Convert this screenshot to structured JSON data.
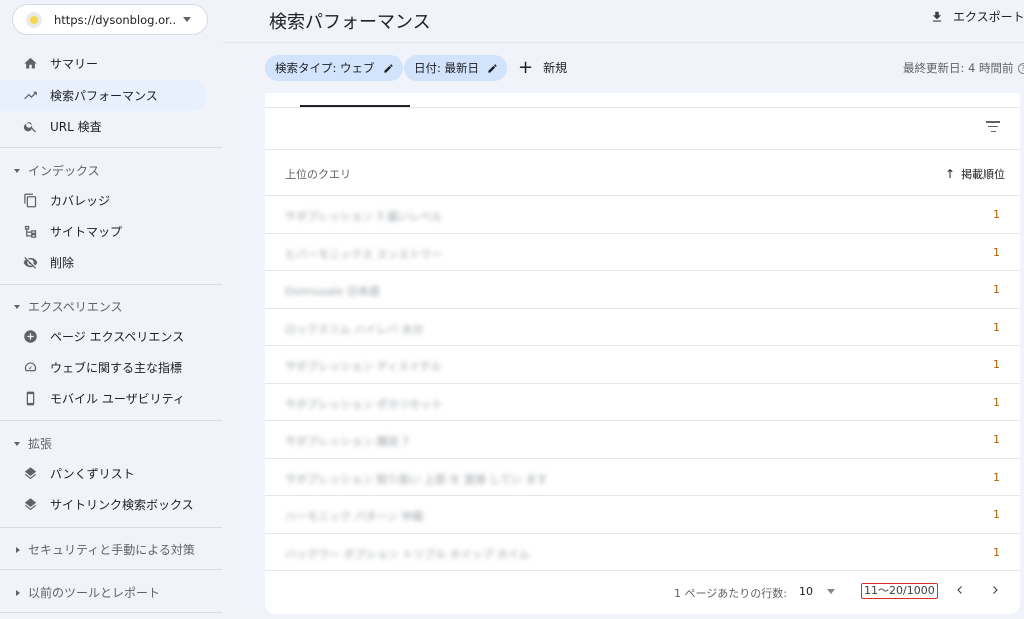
{
  "property": {
    "url": "https://dysonblog.or..."
  },
  "nav": {
    "summary": "サマリー",
    "performance": "検索パフォーマンス",
    "url_inspection": "URL 検査",
    "index_section": "インデックス",
    "coverage": "カバレッジ",
    "sitemaps": "サイトマップ",
    "removals": "削除",
    "experience_section": "エクスペリエンス",
    "page_experience": "ページ エクスペリエンス",
    "web_vitals": "ウェブに関する主な指標",
    "mobile_usability": "モバイル ユーザビリティ",
    "enhancements_section": "拡張",
    "breadcrumbs": "パンくずリスト",
    "sitelinks": "サイトリンク検索ボックス",
    "security_section": "セキュリティと手動による対策",
    "legacy_section": "以前のツールとレポート"
  },
  "header": {
    "title": "検索パフォーマンス",
    "export_label": "エクスポート",
    "chip_search_type": "検索タイプ: ウェブ",
    "chip_date": "日付: 最新日",
    "new_label": "新規",
    "last_updated": "最終更新日: 4 時間前"
  },
  "table": {
    "col_query": "上位のクエリ",
    "col_position": "掲載順位",
    "rows": [
      {
        "query": "サボプレッション 3 届いレベル",
        "position": "1"
      },
      {
        "query": "ヒバーモニックス スンストワー",
        "position": "1"
      },
      {
        "query": "Dolmusale 日本語",
        "position": "1"
      },
      {
        "query": "ロックスリム ハイレバ 水分",
        "position": "1"
      },
      {
        "query": "サボプレッション ディスイテル",
        "position": "1"
      },
      {
        "query": "サボプレッション ポカリセット",
        "position": "1"
      },
      {
        "query": "サボプレッション 雑誌 7",
        "position": "1"
      },
      {
        "query": "サボプレッション 取り扱い 上部 を 直接 してい ます",
        "position": "1"
      },
      {
        "query": "ハーモニック パターン 仲裁",
        "position": "1"
      },
      {
        "query": "バックワー ボプション トリプル ホイップ ホイム",
        "position": "1"
      }
    ]
  },
  "pager": {
    "rows_per_page_label": "1 ページあたりの行数:",
    "rows_per_page_value": "10",
    "range": "11～20/1000"
  },
  "colors": {
    "accent_chip": "#d2e3fc",
    "active_nav": "#e8f0fe",
    "position_text": "#b06000",
    "highlight_box": "#d93025"
  },
  "icons": [
    "home-icon",
    "trending-up-icon",
    "search-icon",
    "copy-icon",
    "sitemap-icon",
    "eye-off-icon",
    "add-circle-icon",
    "gauge-icon",
    "phone-icon",
    "layers-icon",
    "download-icon",
    "edit-icon",
    "plus-icon",
    "filter-icon",
    "arrow-up-icon",
    "chevron-left-icon",
    "chevron-right-icon"
  ]
}
